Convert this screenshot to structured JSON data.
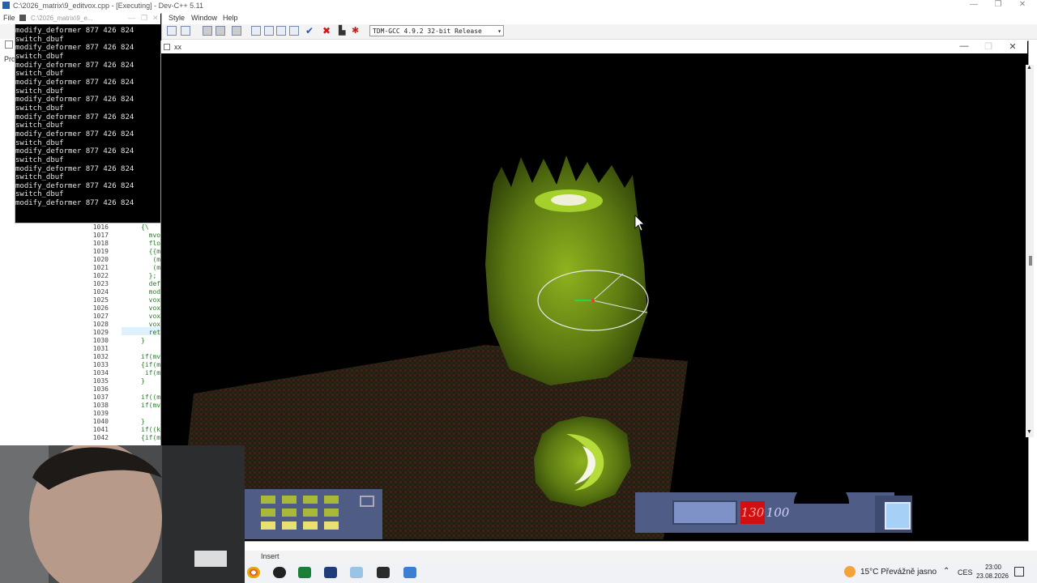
{
  "devcpp": {
    "title": "C:\\2026_matrix\\9_editvox.cpp - [Executing] - Dev-C++ 5.11",
    "window_controls": [
      "—",
      "❐",
      "✕"
    ],
    "menu": [
      "File",
      "Style",
      "Window",
      "Help"
    ],
    "compiler_select": "TDM-GCC 4.9.2 32-bit Release",
    "project_tab": "Pro",
    "status_mode": "Insert"
  },
  "editor": {
    "line_numbers": [
      "1016",
      "1017",
      "1018",
      "1019",
      "1020",
      "1021",
      "1022",
      "1023",
      "1024",
      "1025",
      "1026",
      "1027",
      "1028",
      "1029",
      "1030",
      "1031",
      "1032",
      "1033",
      "1034",
      "1035",
      "1036",
      "1037",
      "1038",
      "1039",
      "1040",
      "1041",
      "1042"
    ],
    "code_snippets": [
      {
        "line": "1016",
        "text": "{\\"
      },
      {
        "line": "1017",
        "text": "  mvo"
      },
      {
        "line": "1018",
        "text": "  flo"
      },
      {
        "line": "1019",
        "text": "  {{m"
      },
      {
        "line": "1020",
        "text": "   (m"
      },
      {
        "line": "1021",
        "text": "   (m"
      },
      {
        "line": "1022",
        "text": "  };"
      },
      {
        "line": "1023",
        "text": "  def"
      },
      {
        "line": "1024",
        "text": "  mod"
      },
      {
        "line": "1025",
        "text": "  vox"
      },
      {
        "line": "1026",
        "text": "  vox"
      },
      {
        "line": "1027",
        "text": "  vox"
      },
      {
        "line": "1028",
        "text": "  vox"
      },
      {
        "line": "1029",
        "text": "  ret"
      },
      {
        "line": "1030",
        "text": "}"
      },
      {
        "line": "1031",
        "text": ""
      },
      {
        "line": "1032",
        "text": "if(mv"
      },
      {
        "line": "1033",
        "text": "{if(m"
      },
      {
        "line": "1034",
        "text": " if(m"
      },
      {
        "line": "1035",
        "text": "}"
      },
      {
        "line": "1036",
        "text": ""
      },
      {
        "line": "1037",
        "text": "if((m"
      },
      {
        "line": "1038",
        "text": "if(mv"
      },
      {
        "line": "1039",
        "text": ""
      },
      {
        "line": "1040",
        "text": "}"
      },
      {
        "line": "1041",
        "text": "if((ke"
      },
      {
        "line": "1042",
        "text": "{if(mv"
      }
    ]
  },
  "console": {
    "title": "C:\\2026_matrix\\9_e...",
    "lines": [
      "modify_deformer 877 426 824",
      "switch_dbuf",
      "modify_deformer 877 426 824",
      "switch_dbuf",
      "modify_deformer 877 426 824",
      "switch_dbuf",
      "modify_deformer 877 426 824",
      "switch_dbuf",
      "modify_deformer 877 426 824",
      "switch_dbuf",
      "modify_deformer 877 426 824",
      "switch_dbuf",
      "modify_deformer 877 426 824",
      "switch_dbuf",
      "modify_deformer 877 426 824",
      "switch_dbuf",
      "modify_deformer 877 426 824",
      "switch_dbuf",
      "modify_deformer 877 426 824",
      "switch_dbuf",
      "modify_deformer 877 426 824"
    ]
  },
  "game": {
    "title": "xx",
    "hud_red_value": "130",
    "hud_value": "100",
    "colors": {
      "voxel_green": "#6f8f14",
      "voxel_light": "#9bc22a",
      "hud_blue": "#4e5c86",
      "hud_red": "#d01010"
    }
  },
  "taskbar": {
    "weather_temp": "15°C",
    "weather_desc": "Převážně jasno",
    "tray_chevron": "⌃",
    "language": "CES",
    "time": "23:00",
    "date": "23.08.2026",
    "icons": [
      "chrome-icon",
      "obs-icon",
      "devcpp-icon",
      "app-icon",
      "notepad-icon",
      "game-icon",
      "window-icon"
    ]
  }
}
